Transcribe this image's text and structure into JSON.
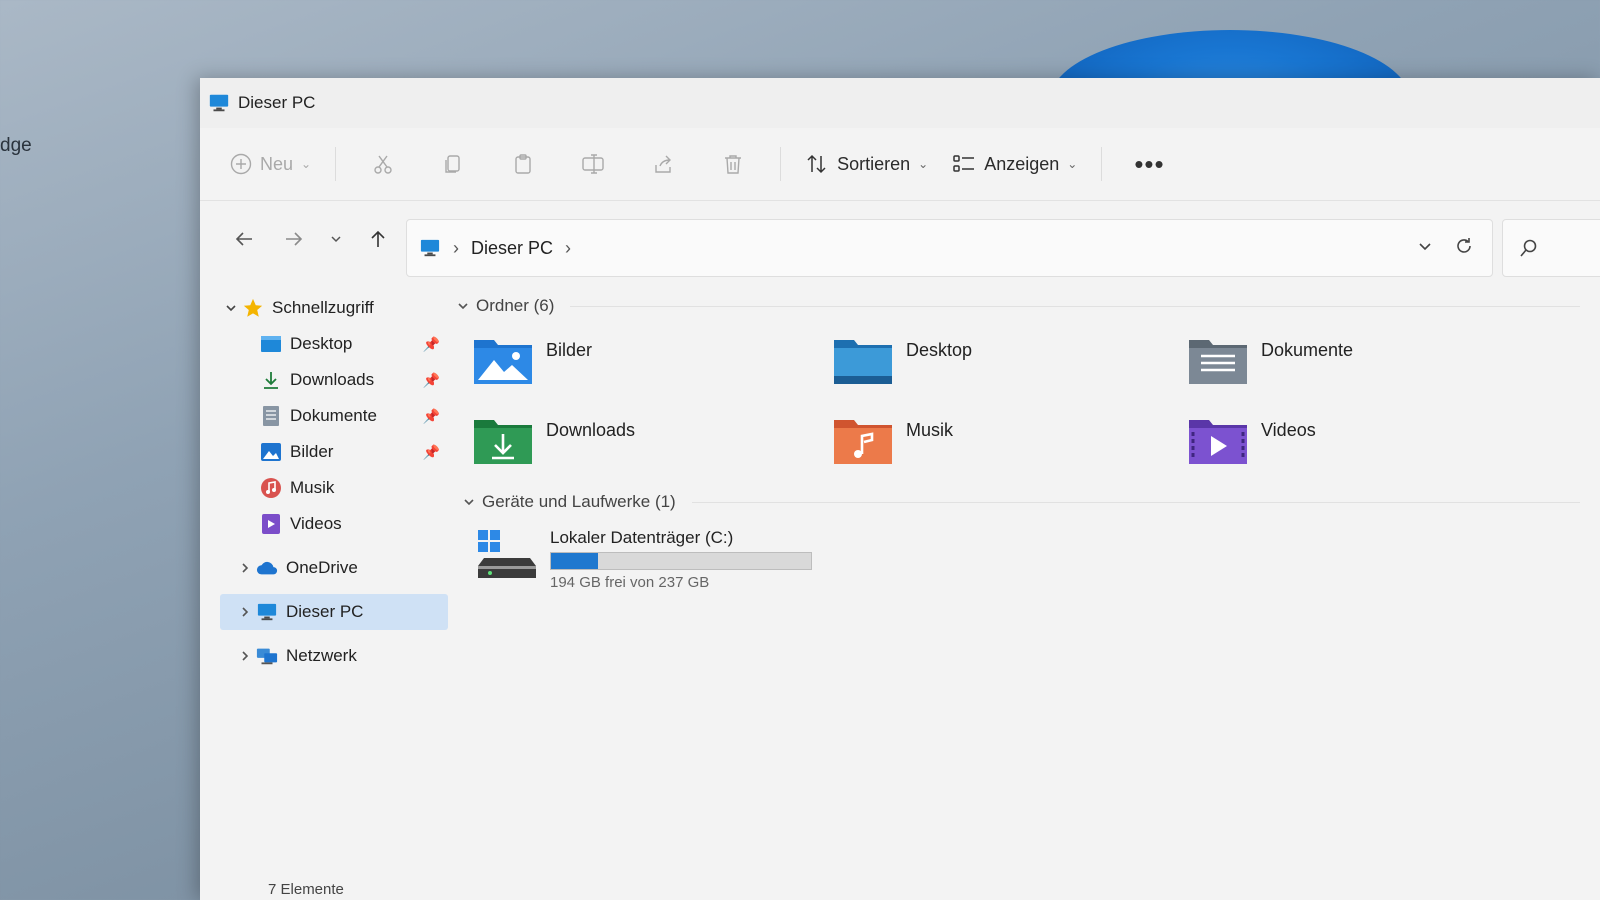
{
  "desktop": {
    "edge_label": "dge"
  },
  "window": {
    "title": "Dieser PC"
  },
  "toolbar": {
    "new_label": "Neu",
    "sort_label": "Sortieren",
    "view_label": "Anzeigen",
    "more_label": "•••"
  },
  "address": {
    "crumbs": [
      "Dieser PC"
    ]
  },
  "sidebar": {
    "quick_access": "Schnellzugriff",
    "items": [
      {
        "label": "Desktop"
      },
      {
        "label": "Downloads"
      },
      {
        "label": "Dokumente"
      },
      {
        "label": "Bilder"
      },
      {
        "label": "Musik"
      },
      {
        "label": "Videos"
      }
    ],
    "onedrive": "OneDrive",
    "thispc": "Dieser PC",
    "network": "Netzwerk"
  },
  "content": {
    "folders_header": "Ordner (6)",
    "folders": [
      {
        "label": "Bilder"
      },
      {
        "label": "Desktop"
      },
      {
        "label": "Dokumente"
      },
      {
        "label": "Downloads"
      },
      {
        "label": "Musik"
      },
      {
        "label": "Videos"
      }
    ],
    "devices_header": "Geräte und Laufwerke (1)",
    "drive": {
      "name": "Lokaler Datenträger (C:)",
      "free": "194 GB frei von 237 GB",
      "used_fraction": 0.18
    }
  },
  "status": {
    "count": "7 Elemente"
  },
  "colors": {
    "accent": "#1f78cf",
    "selection": "#cfe1f5"
  }
}
